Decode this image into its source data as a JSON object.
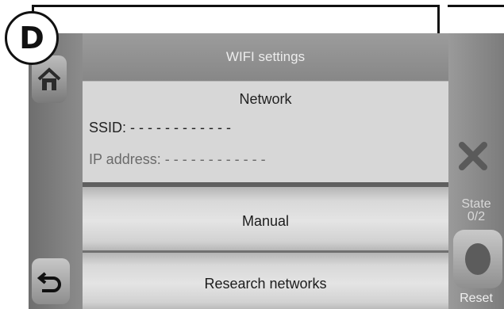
{
  "badge_letter": "D",
  "header": {
    "title": "WIFI settings"
  },
  "network": {
    "title": "Network",
    "ssid": "SSID: - - - - - - - - - - - -",
    "ip_address": "IP address: - - - - - - - - - - - -"
  },
  "menu": {
    "manual": "Manual",
    "research_networks": "Research networks"
  },
  "right_panel": {
    "state_label": "State",
    "state_value": "0/2",
    "reset_label": "Reset"
  },
  "icons": {
    "home": "home-icon",
    "back": "back-arrow-icon",
    "close": "close-icon"
  }
}
